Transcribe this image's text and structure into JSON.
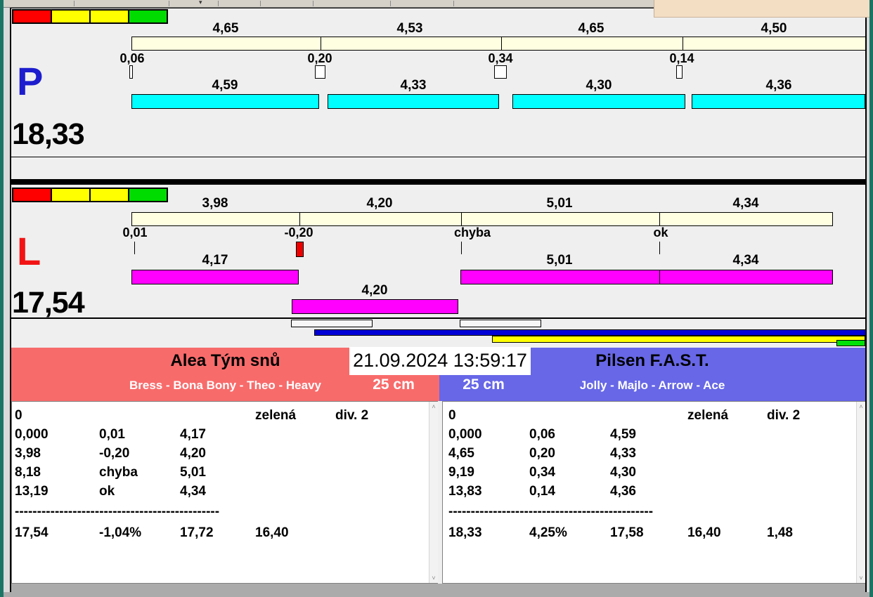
{
  "datetime": "21.09.2024 13:59:17",
  "icons": {
    "scroll_up": "˄",
    "scroll_down": "˅",
    "caret_down": "▾"
  },
  "colors": {
    "panel_background": "#EFEFEF",
    "top_bar": "#FFFFE1",
    "lane_p_bar": "#00FFFF",
    "lane_l_bar": "#FF00FF",
    "status_red": "#FF0000",
    "status_yellow": "#FFFF00",
    "status_green": "#00DB00",
    "team_left": "#F86B6B",
    "team_right": "#6767E7",
    "progress_blue": "#0000D6",
    "progress_yellow": "#FFFF00",
    "progress_green": "#00E109",
    "letter_p": "#1D1DCE",
    "letter_l": "#F21414"
  },
  "lane_p": {
    "letter": "P",
    "total": "18,33",
    "status_lights": [
      "red",
      "yellow",
      "yellow",
      "green"
    ],
    "top_segments": [
      "4,65",
      "4,53",
      "4,65",
      "4,50"
    ],
    "marks": [
      "0,06",
      "0,20",
      "0,34",
      "0,14"
    ],
    "bottom_segments": [
      "4,59",
      "4,33",
      "4,30",
      "4,36"
    ]
  },
  "lane_l": {
    "letter": "L",
    "total": "17,54",
    "status_lights": [
      "red",
      "yellow",
      "yellow",
      "green"
    ],
    "top_segments": [
      "3,98",
      "4,20",
      "5,01",
      "4,34"
    ],
    "marks": [
      "0,01",
      "-0,20",
      "chyba",
      "ok"
    ],
    "bottom_segments": [
      "4,17",
      "5,01",
      "4,34"
    ],
    "offset_segment": "4,20"
  },
  "teams": {
    "left": {
      "name": "Alea Tým snů",
      "players": "Bress - Bona Bony - Theo - Heavy",
      "distance": "25 cm"
    },
    "right": {
      "name": "Pilsen F.A.S.T.",
      "players": "Jolly - Majlo - Arrow - Ace",
      "distance": "25 cm"
    }
  },
  "tables": {
    "left": {
      "head": {
        "col1": "0",
        "col4": "zelená",
        "col5": "div. 2"
      },
      "rows": [
        [
          "0,000",
          "0,01",
          "4,17"
        ],
        [
          "3,98",
          "-0,20",
          "4,20"
        ],
        [
          "8,18",
          "chyba",
          "5,01"
        ],
        [
          "13,19",
          "ok",
          "4,34"
        ]
      ],
      "divider": "----------------------------------------------",
      "totals": [
        "17,54",
        "-1,04%",
        "17,72",
        "16,40"
      ]
    },
    "right": {
      "head": {
        "col1": "0",
        "col4": "zelená",
        "col5": "div. 2"
      },
      "rows": [
        [
          "0,000",
          "0,06",
          "4,59"
        ],
        [
          "4,65",
          "0,20",
          "4,33"
        ],
        [
          "9,19",
          "0,34",
          "4,30"
        ],
        [
          "13,83",
          "0,14",
          "4,36"
        ]
      ],
      "divider": "----------------------------------------------",
      "totals": [
        "18,33",
        "4,25%",
        "17,58",
        "16,40",
        "1,48"
      ]
    }
  }
}
